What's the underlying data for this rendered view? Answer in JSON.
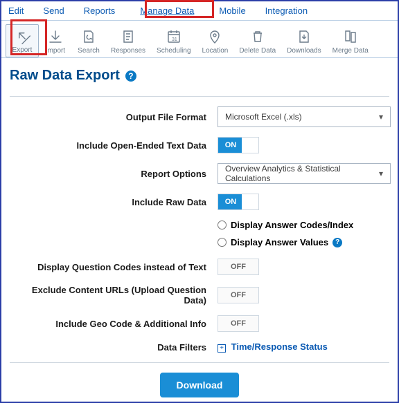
{
  "nav": {
    "edit": "Edit",
    "send": "Send",
    "reports": "Reports",
    "manage_data": "Manage Data",
    "mobile": "Mobile",
    "integration": "Integration"
  },
  "toolbar": {
    "export": "Export",
    "import": "Import",
    "search": "Search",
    "responses": "Responses",
    "scheduling": "Scheduling",
    "location": "Location",
    "delete_data": "Delete Data",
    "downloads": "Downloads",
    "merge_data": "Merge Data"
  },
  "page_title": "Raw Data Export",
  "labels": {
    "output_format": "Output File Format",
    "include_open_ended": "Include Open-Ended Text Data",
    "report_options": "Report Options",
    "include_raw": "Include Raw Data",
    "display_codes": "Display Answer Codes/Index",
    "display_values": "Display Answer Values",
    "display_q_codes": "Display Question Codes instead of Text",
    "exclude_urls": "Exclude Content URLs (Upload Question Data)",
    "include_geo": "Include Geo Code & Additional Info",
    "data_filters": "Data Filters"
  },
  "values": {
    "output_format_selected": "Microsoft Excel (.xls)",
    "report_options_selected": "Overview Analytics & Statistical Calculations",
    "on": "ON",
    "off": "OFF",
    "filters_link": "Time/Response Status",
    "download": "Download"
  }
}
